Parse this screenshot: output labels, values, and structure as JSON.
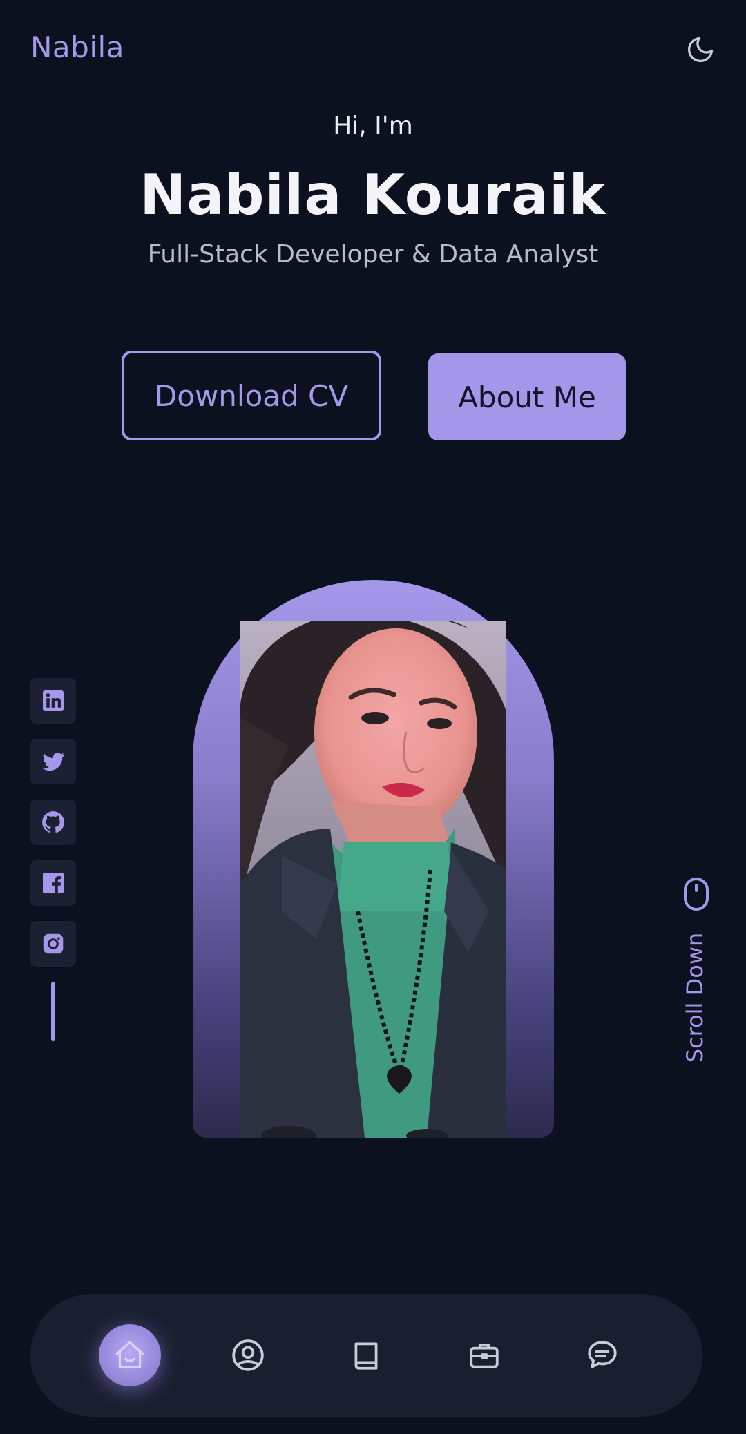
{
  "header": {
    "brand": "Nabila",
    "theme_icon": "moon-icon"
  },
  "hero": {
    "greeting": "Hi, I'm",
    "name": "Nabila Kouraik",
    "role": "Full-Stack Developer & Data Analyst",
    "download_cv_label": "Download CV",
    "about_me_label": "About Me"
  },
  "socials": [
    {
      "icon": "linkedin-icon"
    },
    {
      "icon": "twitter-icon"
    },
    {
      "icon": "github-icon"
    },
    {
      "icon": "facebook-icon"
    },
    {
      "icon": "instagram-icon"
    }
  ],
  "scroll": {
    "label": "Scroll Down",
    "icon": "mouse-icon"
  },
  "nav": [
    {
      "icon": "home-icon",
      "active": true
    },
    {
      "icon": "user-icon",
      "active": false
    },
    {
      "icon": "book-icon",
      "active": false
    },
    {
      "icon": "briefcase-icon",
      "active": false
    },
    {
      "icon": "chat-icon",
      "active": false
    }
  ],
  "colors": {
    "background": "#0c1120",
    "accent": "#a597ea",
    "surface": "#1b2032"
  }
}
